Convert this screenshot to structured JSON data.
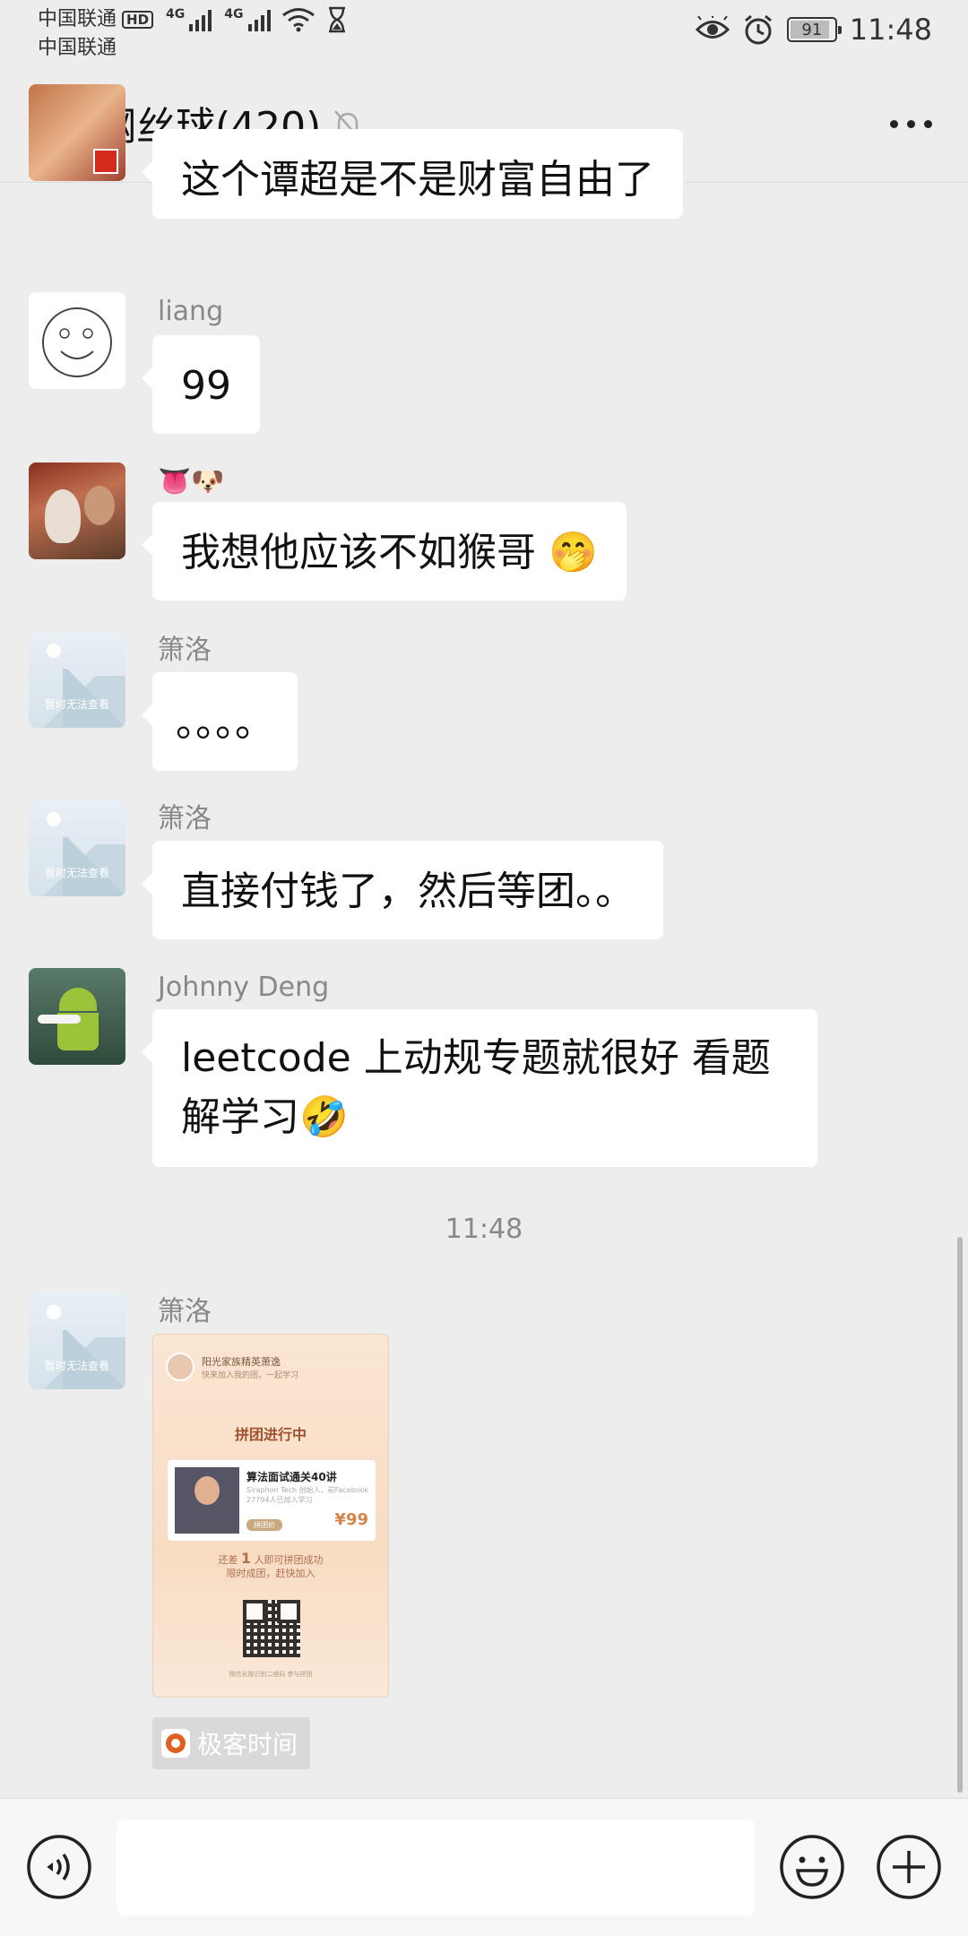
{
  "status_bar": {
    "carrier1": "中国联通",
    "hd_badge": "HD",
    "carrier2": "中国联通",
    "net1": "4G",
    "net2": "4G",
    "battery": "91",
    "time": "11:48"
  },
  "header": {
    "title": "钢丝球(420)"
  },
  "messages": [
    {
      "sender": "",
      "text": "这个谭超是不是财富自由了"
    },
    {
      "sender": "liang",
      "text": "99"
    },
    {
      "sender": "👅🐶",
      "text": "我想他应该不如猴哥 🤭"
    },
    {
      "sender": "箫洛",
      "text": "。。。。",
      "avatar_text": "暂时无法查看"
    },
    {
      "sender": "箫洛",
      "text": "直接付钱了，然后等团。。",
      "avatar_text": "暂时无法查看"
    },
    {
      "sender": "Johnny Deng",
      "text": "leetcode 上动规专题就很好 看题解学习🤣"
    }
  ],
  "timestamp": "11:48",
  "last_message": {
    "sender": "箫洛",
    "avatar_text": "暂时无法查看",
    "poster": {
      "header_title": "阳光家族精英萧逸",
      "header_sub": "快来加入我的团，一起学习",
      "title": "拼团进行中",
      "course_title": "算法面试通关40讲",
      "course_sub": "Siraphon Tech 创始人，前Facebook",
      "course_count": "27794人已加入学习",
      "tag": "拼团价",
      "price": "¥99",
      "note1_pre": "还差",
      "note1_num": "1",
      "note1_post": "人即可拼团成功",
      "note2": "限时成团，赶快加入",
      "footer": "微信长按识别二维码 参与拼团"
    },
    "source_label": "极客时间"
  },
  "icons": {
    "back": "chevron-left-icon",
    "mute": "bell-off-icon",
    "more": "more-icon",
    "voice": "voice-icon",
    "emoji": "emoji-icon",
    "plus": "plus-icon"
  }
}
